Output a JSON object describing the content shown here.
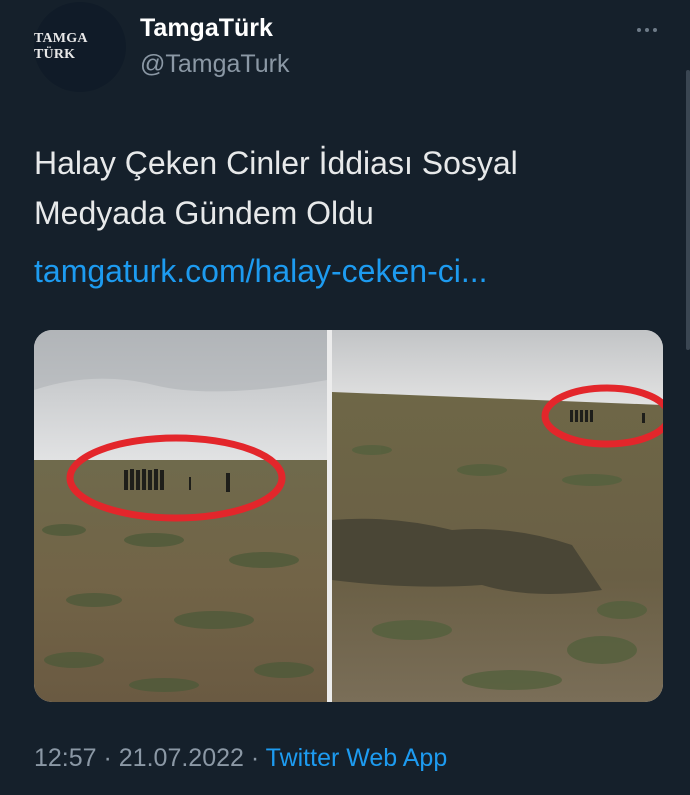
{
  "author": {
    "display_name": "TamgaTürk",
    "handle": "@TamgaTurk",
    "avatar_text": "TAMGA TÜRK"
  },
  "tweet": {
    "text_line1": "Halay Çeken Cinler İddiası Sosyal",
    "text_line2": "Medyada Gündem Oldu",
    "link_text": "tamgaturk.com/halay-ceken-ci..."
  },
  "meta": {
    "time": "12:57",
    "separator": " · ",
    "date": "21.07.2022",
    "source": "Twitter Web App"
  },
  "icons": {
    "more": "more-horizontal-icon"
  },
  "colors": {
    "background": "#15202b",
    "link": "#1d9bf0",
    "secondary_text": "#8b98a5",
    "highlight_circle": "#e3262b"
  }
}
